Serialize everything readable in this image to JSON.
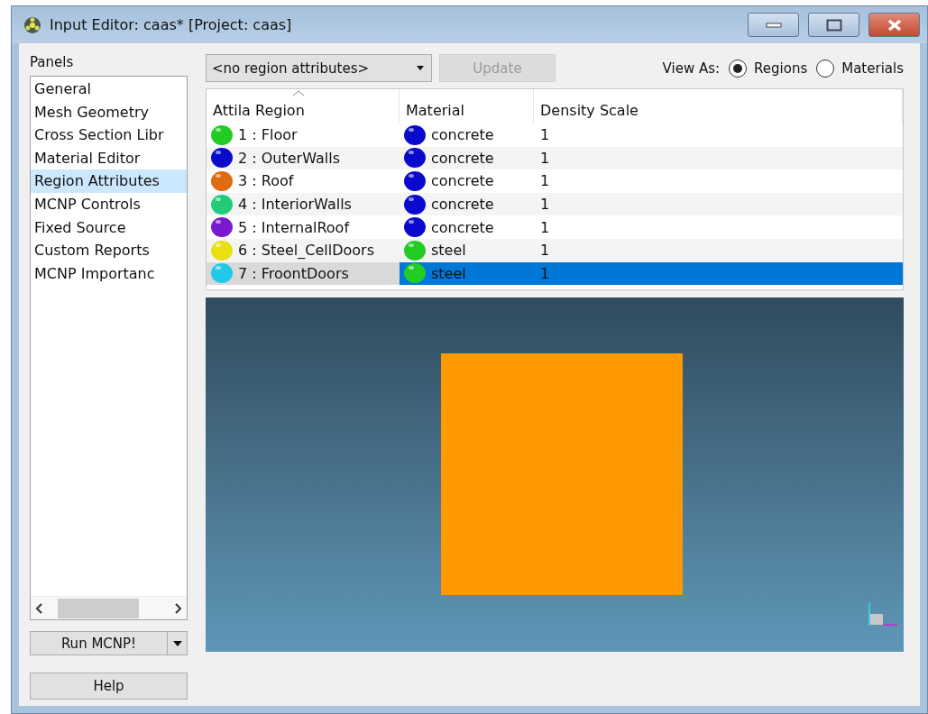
{
  "window": {
    "title": "Input Editor: caas* [Project: caas]"
  },
  "panels": {
    "label": "Panels",
    "items": [
      {
        "label": "General",
        "selected": false
      },
      {
        "label": "Mesh Geometry",
        "selected": false
      },
      {
        "label": "Cross Section Libr",
        "selected": false
      },
      {
        "label": "Material Editor",
        "selected": false
      },
      {
        "label": "Region Attributes",
        "selected": true
      },
      {
        "label": "MCNP Controls",
        "selected": false
      },
      {
        "label": "Fixed Source",
        "selected": false
      },
      {
        "label": "Custom Reports",
        "selected": false
      },
      {
        "label": "MCNP Importanc",
        "selected": false
      }
    ]
  },
  "run_button": "Run MCNP!",
  "help_button": "Help",
  "toolbar": {
    "dropdown": "<no region attributes>",
    "update_button": {
      "label": "Update",
      "disabled": true
    },
    "view_as_label": "View As:",
    "view_options": [
      {
        "label": "Regions",
        "selected": true
      },
      {
        "label": "Materials",
        "selected": false
      }
    ]
  },
  "table": {
    "columns": [
      {
        "label": "Attila Region",
        "sorted": true
      },
      {
        "label": "Material",
        "sorted": false
      },
      {
        "label": "Density Scale",
        "sorted": false
      }
    ],
    "rows": [
      {
        "region": {
          "label": "1 : Floor",
          "color": "#22cc22"
        },
        "material": {
          "label": "concrete",
          "color": "#0a0acc"
        },
        "density": "1",
        "selected": false
      },
      {
        "region": {
          "label": "2 : OuterWalls",
          "color": "#0a0acc"
        },
        "material": {
          "label": "concrete",
          "color": "#0a0acc"
        },
        "density": "1",
        "selected": false
      },
      {
        "region": {
          "label": "3 : Roof",
          "color": "#e06a10"
        },
        "material": {
          "label": "concrete",
          "color": "#0a0acc"
        },
        "density": "1",
        "selected": false
      },
      {
        "region": {
          "label": "4 : InteriorWalls",
          "color": "#22cc77"
        },
        "material": {
          "label": "concrete",
          "color": "#0a0acc"
        },
        "density": "1",
        "selected": false
      },
      {
        "region": {
          "label": "5 : InternalRoof",
          "color": "#7a1ad0"
        },
        "material": {
          "label": "concrete",
          "color": "#0a0acc"
        },
        "density": "1",
        "selected": false
      },
      {
        "region": {
          "label": "6 : Steel_CellDoors",
          "color": "#e8e010"
        },
        "material": {
          "label": "steel",
          "color": "#22cc22"
        },
        "density": "1",
        "selected": false
      },
      {
        "region": {
          "label": "7 : FroontDoors",
          "color": "#22c8e8"
        },
        "material": {
          "label": "steel",
          "color": "#22cc22"
        },
        "density": "1",
        "selected": true
      }
    ]
  }
}
